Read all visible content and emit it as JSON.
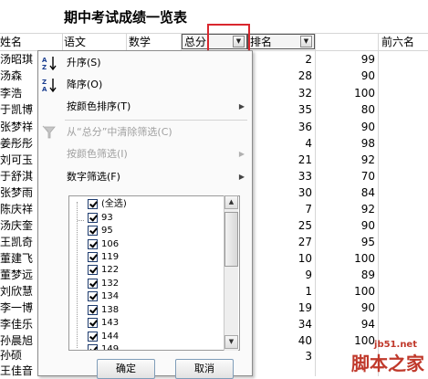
{
  "sheet": {
    "title": "期中考试成绩一览表",
    "headers": {
      "name": "姓名",
      "chinese": "语文",
      "math": "数学",
      "total": "总分",
      "rank": "排名",
      "top6": "前六名"
    },
    "names": [
      "汤昭琪",
      "汤森",
      "李浩",
      "于凯博",
      "张梦祥",
      "姜彤彤",
      "刘可玉",
      "于舒淇",
      "张梦雨",
      "陈庆祥",
      "汤庆奎",
      "王凯奇",
      "董建飞",
      "董梦远",
      "刘欣慧",
      "李一博",
      "李佳乐",
      "孙晨旭",
      "孙硕",
      "王佳音"
    ],
    "totals": [
      "2",
      "28",
      "32",
      "35",
      "36",
      "4",
      "21",
      "33",
      "30",
      "7",
      "25",
      "27",
      "10",
      "9",
      "1",
      "19",
      "34",
      "40",
      "3"
    ],
    "ranks": [
      "99",
      "90",
      "100",
      "80",
      "90",
      "98",
      "92",
      "70",
      "84",
      "92",
      "90",
      "95",
      "100",
      "89",
      "100",
      "90",
      "94",
      "100"
    ]
  },
  "menu": {
    "items": [
      {
        "label": "升序(S)",
        "enabled": true
      },
      {
        "label": "降序(O)",
        "enabled": true
      },
      {
        "label": "按颜色排序(T)",
        "enabled": true
      },
      {
        "label": "从“总分”中清除筛选(C)",
        "enabled": false
      },
      {
        "label": "按颜色筛选(I)",
        "enabled": false
      },
      {
        "label": "数字筛选(F)",
        "enabled": true
      }
    ],
    "list": [
      "(全选)",
      "93",
      "95",
      "106",
      "119",
      "122",
      "132",
      "134",
      "138",
      "143",
      "144",
      "149"
    ],
    "ok": "确定",
    "cancel": "取消"
  },
  "watermark": {
    "site": "jb51.net",
    "brand": "脚本之家"
  },
  "colors": {
    "highlight": "#d9272e",
    "grid": "#d6d6d6",
    "watermark": "#c0392b"
  }
}
